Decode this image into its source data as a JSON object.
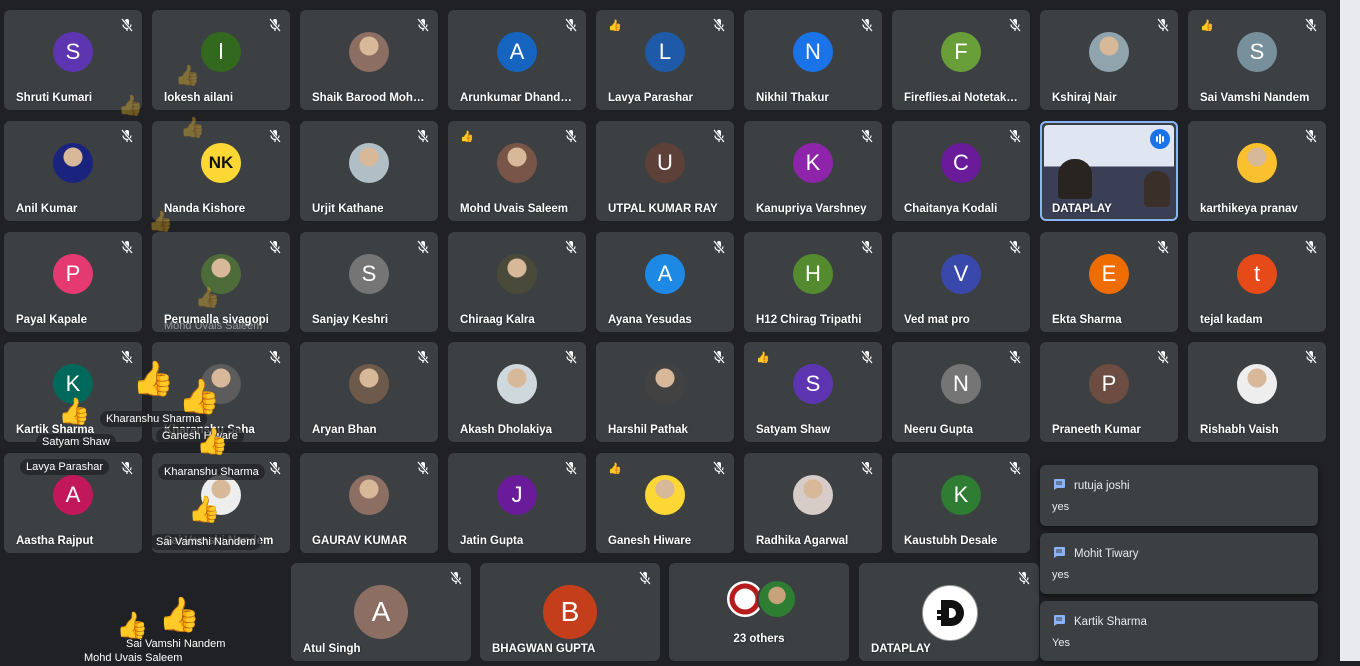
{
  "tiles_row1": [
    {
      "name": "Shruti Kumari",
      "initial": "S",
      "color": "#5e35b1",
      "thumb": false
    },
    {
      "name": "lokesh ailani",
      "initial": "l",
      "color": "#33691e",
      "thumb": false
    },
    {
      "name": "Shaik Barood Moha...",
      "initial": "",
      "color": "#8d6e63",
      "thumb": false
    },
    {
      "name": "Arunkumar Dhanda...",
      "initial": "A",
      "color": "#1565c0",
      "thumb": false
    },
    {
      "name": "Lavya Parashar",
      "initial": "L",
      "color": "#1e5aa8",
      "thumb": true
    },
    {
      "name": "Nikhil Thakur",
      "initial": "N",
      "color": "#1a73e8",
      "thumb": false
    },
    {
      "name": "Fireflies.ai Notetake...",
      "initial": "F",
      "color": "#689f38",
      "thumb": false
    },
    {
      "name": "Kshiraj Nair",
      "initial": "",
      "color": "#90a4ae",
      "thumb": false
    },
    {
      "name": "Sai Vamshi Nandem",
      "initial": "S",
      "color": "#78909c",
      "thumb": true
    }
  ],
  "tiles_row2": [
    {
      "name": "Anil Kumar",
      "initial": "",
      "color": "#1a237e",
      "thumb": false
    },
    {
      "name": "Nanda Kishore",
      "initial": "NK",
      "color": "#fdd835",
      "thumb": false
    },
    {
      "name": "Urjit Kathane",
      "initial": "",
      "color": "#b0bec5",
      "thumb": false
    },
    {
      "name": "Mohd Uvais Saleem",
      "initial": "",
      "color": "#795548",
      "thumb": true
    },
    {
      "name": "UTPAL KUMAR RAY",
      "initial": "U",
      "color": "#5d4037",
      "thumb": false
    },
    {
      "name": "Kanupriya Varshney",
      "initial": "K",
      "color": "#8e24aa",
      "thumb": false
    },
    {
      "name": "Chaitanya Kodali",
      "initial": "C",
      "color": "#6a1b9a",
      "thumb": false
    },
    {
      "name": "DATAPLAY",
      "initial": "",
      "color": "#37474f",
      "thumb": false
    },
    {
      "name": "karthikeya pranav",
      "initial": "",
      "color": "#fbc02d",
      "thumb": false
    }
  ],
  "tiles_row3": [
    {
      "name": "Payal Kapale",
      "initial": "P",
      "color": "#e53972",
      "thumb": false
    },
    {
      "name": "Perumalla sivagopi",
      "initial": "",
      "color": "#4e6b3a",
      "thumb": false
    },
    {
      "name": "Sanjay Keshri",
      "initial": "S",
      "color": "#757575",
      "thumb": false
    },
    {
      "name": "Chiraag Kalra",
      "initial": "",
      "color": "#4a4a3a",
      "thumb": false
    },
    {
      "name": "Ayana Yesudas",
      "initial": "A",
      "color": "#1e88e5",
      "thumb": false
    },
    {
      "name": "H12 Chirag Tripathi",
      "initial": "H",
      "color": "#558b2f",
      "thumb": false
    },
    {
      "name": "Ved mat pro",
      "initial": "V",
      "color": "#3949ab",
      "thumb": false
    },
    {
      "name": "Ekta Sharma",
      "initial": "E",
      "color": "#ef6c00",
      "thumb": false
    },
    {
      "name": "tejal kadam",
      "initial": "t",
      "color": "#e64a19",
      "thumb": false
    }
  ],
  "tiles_row4": [
    {
      "name": "Kartik Sharma",
      "initial": "K",
      "color": "#00695c",
      "thumb": false
    },
    {
      "name": "Kharanshu Saha",
      "initial": "",
      "color": "#5c5c5c",
      "thumb": false
    },
    {
      "name": "Aryan Bhan",
      "initial": "",
      "color": "#6d5a4a",
      "thumb": false
    },
    {
      "name": "Akash Dholakiya",
      "initial": "",
      "color": "#cfd8dc",
      "thumb": false
    },
    {
      "name": "Harshil Pathak",
      "initial": "",
      "color": "#424242",
      "thumb": false
    },
    {
      "name": "Satyam Shaw",
      "initial": "S",
      "color": "#5e35b1",
      "thumb": true
    },
    {
      "name": "Neeru Gupta",
      "initial": "N",
      "color": "#757575",
      "thumb": false
    },
    {
      "name": "Praneeth Kumar",
      "initial": "P",
      "color": "#6d4c41",
      "thumb": false
    },
    {
      "name": "Rishabh Vaish",
      "initial": "",
      "color": "#eeeeee",
      "thumb": false
    }
  ],
  "tiles_row5": [
    {
      "name": "Aastha Rajput",
      "initial": "A",
      "color": "#c2185b",
      "thumb": false
    },
    {
      "name": "Sai Vamshi Nandem",
      "initial": "",
      "color": "#eeeeee",
      "thumb": false
    },
    {
      "name": "GAURAV KUMAR",
      "initial": "",
      "color": "#8d6e63",
      "thumb": false
    },
    {
      "name": "Jatin Gupta",
      "initial": "J",
      "color": "#6a1b9a",
      "thumb": false
    },
    {
      "name": "Ganesh Hiware",
      "initial": "",
      "color": "#fdd835",
      "thumb": true
    },
    {
      "name": "Radhika Agarwal",
      "initial": "",
      "color": "#d7ccc8",
      "thumb": false
    },
    {
      "name": "Kaustubh Desale",
      "initial": "K",
      "color": "#2e7d32",
      "thumb": false
    }
  ],
  "tiles_row6": [
    {
      "name": "Atul Singh",
      "initial": "A",
      "color": "#8d6e63"
    },
    {
      "name": "BHAGWAN GUPTA",
      "initial": "B",
      "color": "#c43e1c"
    },
    {
      "name": "23 others",
      "initial": "",
      "color": "#3c4043"
    },
    {
      "name": "DATAPLAY",
      "initial": "",
      "color": "#ffffff"
    }
  ],
  "chat": [
    {
      "sender": "rutuja joshi",
      "message": "yes"
    },
    {
      "sender": "Mohit Tiwary",
      "message": "yes"
    },
    {
      "sender": "Kartik Sharma",
      "message": "Yes"
    }
  ],
  "reactions": [
    {
      "label": "Mohd Uvais Saleem"
    },
    {
      "label": "Kharanshu Sharma"
    },
    {
      "label": "Satyam Shaw"
    },
    {
      "label": "Ganesh Hiware"
    },
    {
      "label": "Lavya Parashar"
    },
    {
      "label": "Kharanshu Sharma"
    },
    {
      "label": "Sai Vamshi Nandem"
    },
    {
      "label": "Sai Vamshi Nandem"
    },
    {
      "label": "Mohd Uvais Saleem"
    }
  ],
  "icons": {
    "mic_off": "mic-off-icon",
    "thumb": "thumbs-up-icon",
    "chat": "chat-bubble-icon",
    "audio_active": "audio-indicator-icon"
  },
  "colors": {
    "background": "#202124",
    "tile": "#3c4043",
    "active_outline": "#8ab4f8"
  }
}
